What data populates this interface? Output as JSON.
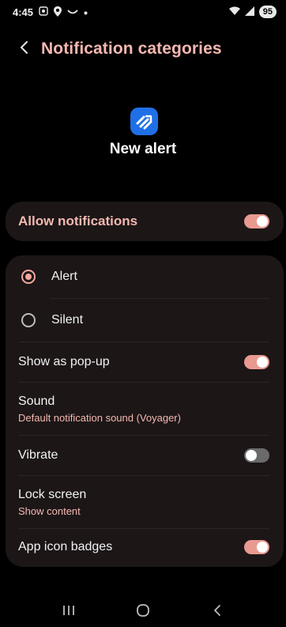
{
  "status_bar": {
    "time": "4:45",
    "battery": "95",
    "icons": [
      "screenshot-icon",
      "location-icon",
      "wave-icon",
      "dot-icon",
      "wifi-icon",
      "signal-icon"
    ]
  },
  "header": {
    "title": "Notification categories",
    "back_icon": "chevron-left-icon"
  },
  "app": {
    "name": "New alert",
    "icon": "app-logo-icon",
    "icon_color": "#1f6fe6"
  },
  "allow": {
    "label": "Allow notifications",
    "on": true
  },
  "alert_options": [
    {
      "label": "Alert",
      "selected": true
    },
    {
      "label": "Silent",
      "selected": false
    }
  ],
  "settings": {
    "popup": {
      "label": "Show as pop-up",
      "on": true
    },
    "sound": {
      "label": "Sound",
      "value": "Default notification sound (Voyager)"
    },
    "vibrate": {
      "label": "Vibrate",
      "on": false
    },
    "lock_screen": {
      "label": "Lock screen",
      "value": "Show content"
    },
    "badges": {
      "label": "App icon badges",
      "on": true
    }
  },
  "colors": {
    "accent": "#f4b8b0",
    "toggle_on": "#e89a90",
    "card_bg": "#1c1617"
  },
  "nav": {
    "icons": [
      "recents-icon",
      "home-icon",
      "back-icon"
    ]
  }
}
